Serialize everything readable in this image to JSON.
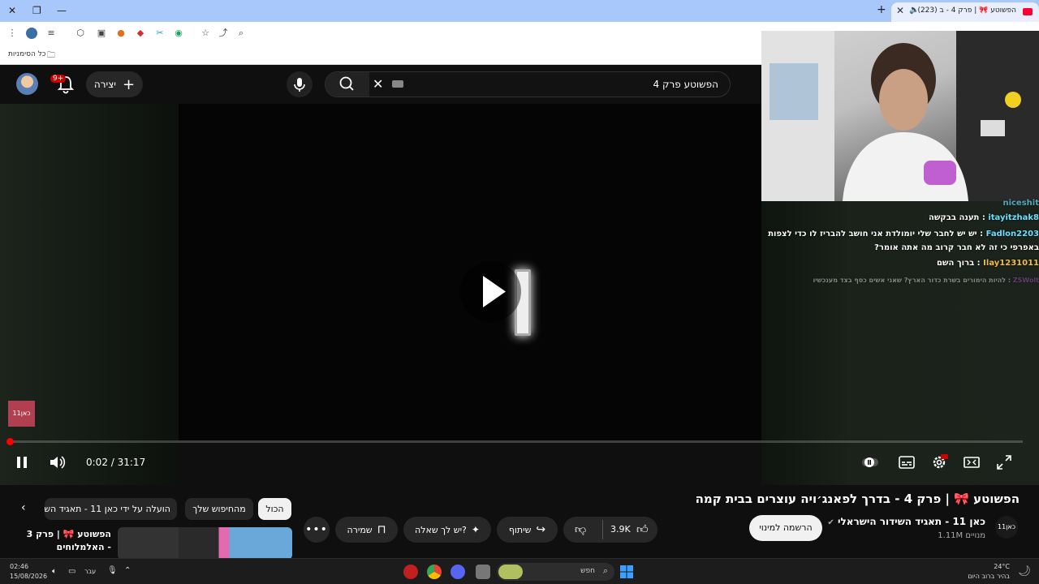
{
  "browser": {
    "tab_title": "(223) הפשוטע 🎀 | פרק 4 - ב",
    "bookmarks_label": "כל הסימניות"
  },
  "header": {
    "notif_badge": "9+",
    "create_label": "יצירה",
    "search_query": "הפשוטע פרק 4"
  },
  "player": {
    "channel_watermark": "כאן11",
    "time_current": "0:02",
    "time_total": "31:17",
    "time_display": "0:02 / 31:17",
    "progress_fraction": 0.0011
  },
  "chat": {
    "lines": [
      {
        "user": "niceshit",
        "text": ""
      },
      {
        "user": "itayitzhak8",
        "text": "תענה בבקשה"
      },
      {
        "user": "Fadlon2203",
        "text": "יש יש לחבר שלי יומולדת אני חושב להבריז לו כדי לצפות"
      },
      {
        "user": "",
        "text": "באפרפי כי זה לא חבר קרוב מה אתה אומר?"
      },
      {
        "user": "Ilay1231011",
        "text": "ברוך השם"
      },
      {
        "user": "ZSWolt",
        "text": "להיות הימורים בשרת כדור הארץ? שאני אשים כסף בצד מענכשיו"
      }
    ]
  },
  "video": {
    "title": "הפשוטע 🎀 | פרק 4 - בדרך לפאנג׳ויה עוצרים בבית קמה",
    "channel_name": "כאן 11 - תאגיד השידור הישראלי",
    "subscribers": "1.11M מנויים",
    "channel_logo": "כאן11",
    "subscribe_label": "הרשמה למינוי",
    "likes": "3.9K",
    "share_label": "שיתוף",
    "ask_label": "יש לך שאלה?",
    "save_label": "שמירה"
  },
  "chips": {
    "all": "הכול",
    "from_search": "מהחיפוש שלך",
    "uploaded_by": "הועלה על ידי כאן 11 - תאגיד השי"
  },
  "recommendation": {
    "title": "הפשוטע 🎀 | פרק 3 - האלמלוחים"
  },
  "taskbar": {
    "time": "02:46",
    "date": "15/08/2026",
    "lang": "עבר",
    "search_label": "חפש",
    "weather_temp": "24°C",
    "weather_desc": "בהיר ברוב היום"
  },
  "colors": {
    "accent": "#ff0000",
    "chrome_tab_bar": "#a8c7fa",
    "yt_bg": "#0f0f0f"
  }
}
